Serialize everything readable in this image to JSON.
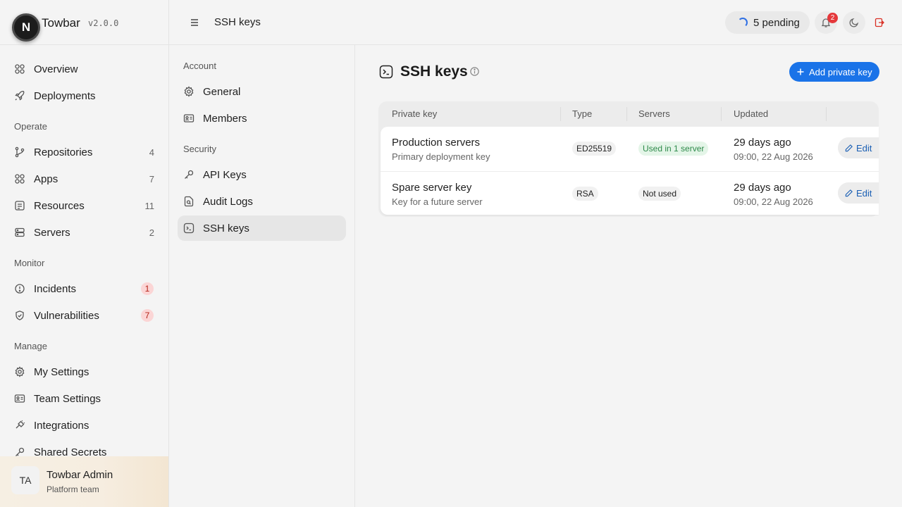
{
  "brand": {
    "logo_letter": "N",
    "name": "Towbar",
    "version": "v2.0.0"
  },
  "sidebar": {
    "top_items": [
      {
        "label": "Overview",
        "icon": "grid-icon"
      },
      {
        "label": "Deployments",
        "icon": "rocket-icon"
      }
    ],
    "sections": [
      {
        "title": "Operate",
        "items": [
          {
            "label": "Repositories",
            "count": "4"
          },
          {
            "label": "Apps",
            "count": "7"
          },
          {
            "label": "Resources",
            "count": "11"
          },
          {
            "label": "Servers",
            "count": "2"
          }
        ]
      },
      {
        "title": "Monitor",
        "items": [
          {
            "label": "Incidents",
            "badge": "1"
          },
          {
            "label": "Vulnerabilities",
            "badge": "7"
          }
        ]
      },
      {
        "title": "Manage",
        "items": [
          {
            "label": "My Settings"
          },
          {
            "label": "Team Settings"
          },
          {
            "label": "Integrations"
          },
          {
            "label": "Shared Secrets"
          }
        ]
      }
    ],
    "user": {
      "initials": "TA",
      "name": "Towbar Admin",
      "team": "Platform team"
    }
  },
  "topbar": {
    "breadcrumb": "SSH keys",
    "pending_label": "5 pending",
    "notifications_count": "2"
  },
  "subnav": {
    "sections": [
      {
        "title": "Account",
        "items": [
          {
            "label": "General"
          },
          {
            "label": "Members"
          }
        ]
      },
      {
        "title": "Security",
        "items": [
          {
            "label": "API Keys"
          },
          {
            "label": "Audit Logs"
          },
          {
            "label": "SSH keys",
            "active": true
          }
        ]
      }
    ]
  },
  "main": {
    "title": "SSH keys",
    "add_button_label": "Add private key",
    "table": {
      "headers": [
        "Private key",
        "Type",
        "Servers",
        "Updated"
      ],
      "rows": [
        {
          "name": "Production servers",
          "description": "Primary deployment key",
          "type": "ED25519",
          "servers": "Used in 1 server",
          "servers_status": "used",
          "updated_relative": "29 days ago",
          "updated_date": "09:00, 22 Aug 2026",
          "action": "Edit"
        },
        {
          "name": "Spare server key",
          "description": "Key for a future server",
          "type": "RSA",
          "servers": "Not used",
          "servers_status": "unused",
          "updated_relative": "29 days ago",
          "updated_date": "09:00, 22 Aug 2026",
          "action": "Edit"
        }
      ]
    }
  },
  "colors": {
    "accent": "#1a73e8",
    "danger_badge_bg": "#fbd5d5",
    "success_pill_bg": "#e4f5e8",
    "success_text": "#2e8a4a",
    "notification_badge": "#e5383b"
  }
}
